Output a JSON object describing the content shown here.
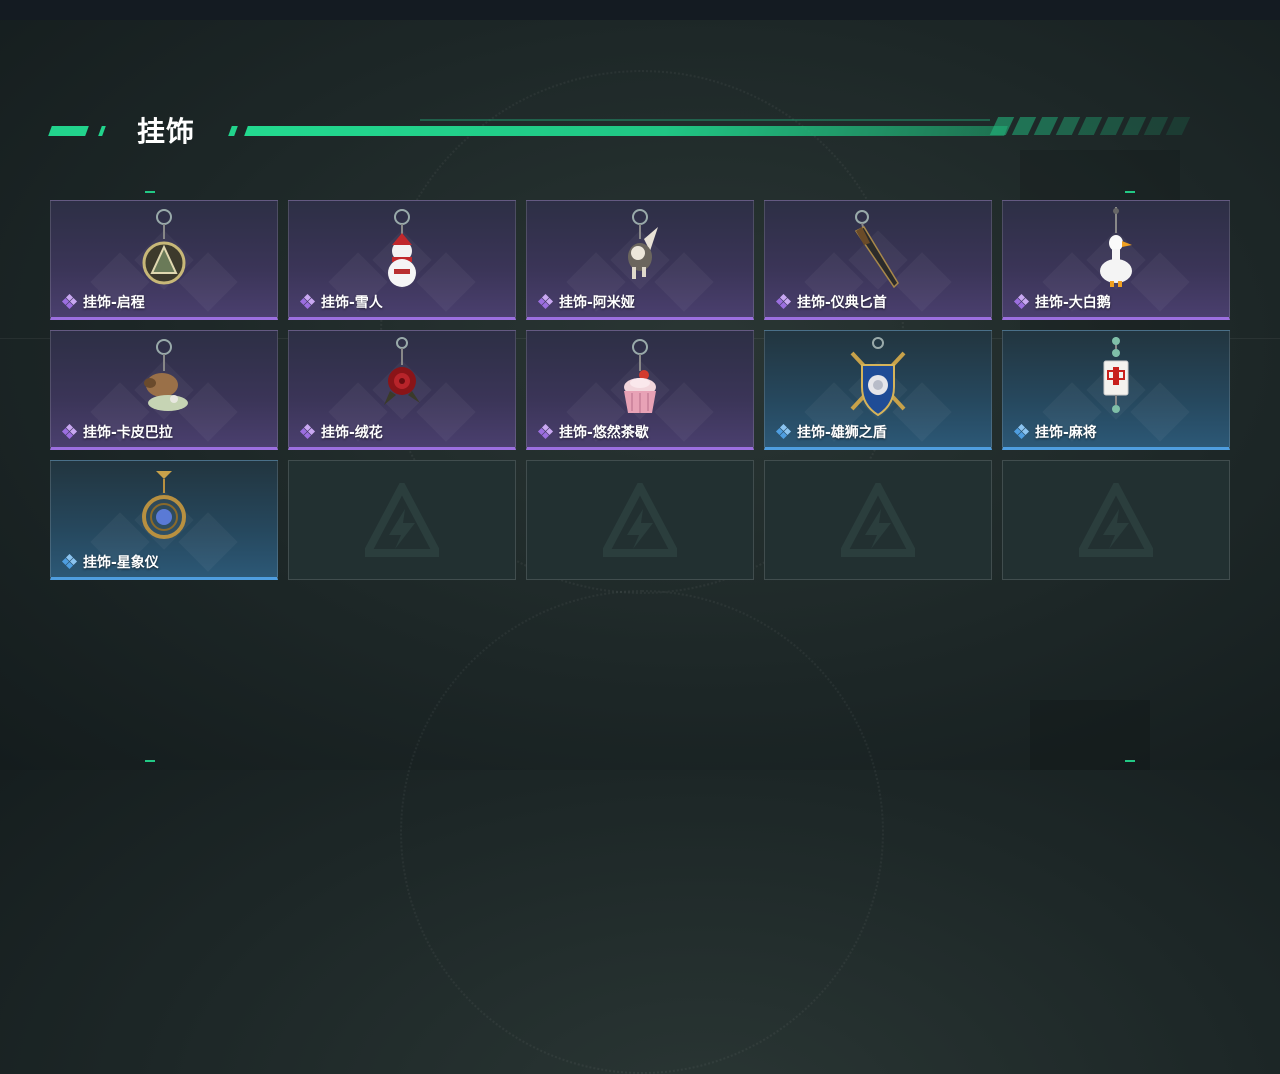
{
  "header": {
    "title": "挂饰"
  },
  "colors": {
    "accent": "#22d38c",
    "purple_rarity": "#9c6fe0",
    "blue_rarity": "#4f9ee0"
  },
  "items": [
    {
      "label": "挂饰-启程",
      "rarity": "purple",
      "icon": "compass-pendant-icon"
    },
    {
      "label": "挂饰-雪人",
      "rarity": "purple",
      "icon": "snowman-icon"
    },
    {
      "label": "挂饰-阿米娅",
      "rarity": "purple",
      "icon": "bunny-doll-icon"
    },
    {
      "label": "挂饰-仪典匕首",
      "rarity": "purple",
      "icon": "dagger-icon"
    },
    {
      "label": "挂饰-大白鹅",
      "rarity": "purple",
      "icon": "goose-icon"
    },
    {
      "label": "挂饰-卡皮巴拉",
      "rarity": "purple",
      "icon": "capybara-icon"
    },
    {
      "label": "挂饰-绒花",
      "rarity": "purple",
      "icon": "rose-icon"
    },
    {
      "label": "挂饰-悠然茶歇",
      "rarity": "purple",
      "icon": "cupcake-icon"
    },
    {
      "label": "挂饰-雄狮之盾",
      "rarity": "blue",
      "icon": "lion-shield-icon"
    },
    {
      "label": "挂饰-麻将",
      "rarity": "blue",
      "icon": "mahjong-tile-icon"
    },
    {
      "label": "挂饰-星象仪",
      "rarity": "blue",
      "icon": "astrolabe-icon"
    }
  ],
  "empty_slots": 4
}
